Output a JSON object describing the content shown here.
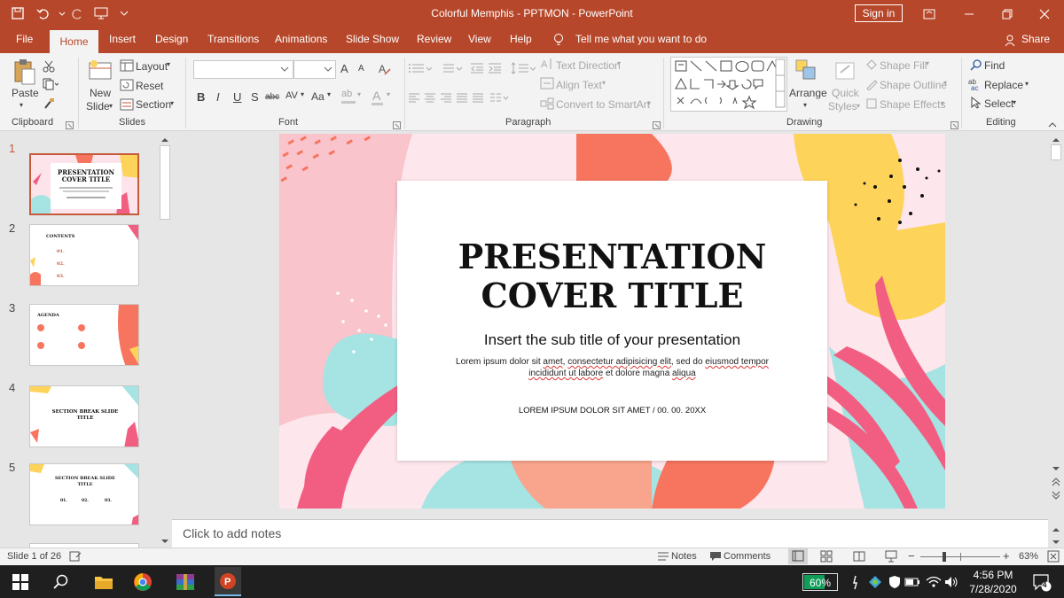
{
  "window": {
    "doc_title": "Colorful Memphis - PPTMON  -  PowerPoint",
    "sign_in": "Sign in"
  },
  "tabs": [
    "File",
    "Home",
    "Insert",
    "Design",
    "Transitions",
    "Animations",
    "Slide Show",
    "Review",
    "View",
    "Help"
  ],
  "tell_me": "Tell me what you want to do",
  "share": "Share",
  "ribbon": {
    "clipboard": {
      "paste": "Paste",
      "group": "Clipboard"
    },
    "slides": {
      "new_line1": "New",
      "new_line2": "Slide",
      "layout": "Layout",
      "reset": "Reset",
      "section": "Section",
      "group": "Slides"
    },
    "font": {
      "group": "Font",
      "style_buttons": [
        "B",
        "I",
        "U",
        "S",
        "abc",
        "AV",
        "Aa"
      ],
      "grow": "A",
      "shrink": "A",
      "color": "A",
      "highlight": "ab"
    },
    "paragraph": {
      "text_direction": "Text Direction",
      "align_text": "Align Text",
      "convert_smartart": "Convert to SmartArt",
      "group": "Paragraph"
    },
    "drawing": {
      "arrange": "Arrange",
      "quick_styles_1": "Quick",
      "quick_styles_2": "Styles",
      "shape_fill": "Shape Fill",
      "shape_outline": "Shape Outline",
      "shape_effects": "Shape Effects",
      "group": "Drawing"
    },
    "editing": {
      "find": "Find",
      "replace": "Replace",
      "select": "Select",
      "group": "Editing"
    }
  },
  "thumbnails": [
    {
      "num": "1",
      "title": "PRESENTATION COVER TITLE"
    },
    {
      "num": "2",
      "title": "CONTENTS",
      "items": [
        "01.",
        "02.",
        "03."
      ]
    },
    {
      "num": "3",
      "title": "AGENDA"
    },
    {
      "num": "4",
      "title": "SECTION BREAK SLIDE TITLE"
    },
    {
      "num": "5",
      "title": "SECTION BREAK SLIDE TITLE",
      "items": [
        "01.",
        "02.",
        "03."
      ]
    }
  ],
  "slide": {
    "title_line1": "PRESENTATION",
    "title_line2": "COVER TITLE",
    "subtitle": "Insert the sub title of your presentation",
    "body": {
      "plain1": "Lorem ipsum dolor sit ",
      "u1": "amet",
      "plain2": ", ",
      "u2": "consectetur adipisicing elit",
      "plain3": ", sed do ",
      "u3": "eiusmod tempor incididunt ut labore",
      "plain4": " et dolore magna ",
      "u4": "aliqua"
    },
    "dateline": "LOREM IPSUM DOLOR SIT AMET  /  00. 00. 20XX"
  },
  "notes_placeholder": "Click to add notes",
  "status": {
    "slide_count": "Slide 1 of 26",
    "notes": "Notes",
    "comments": "Comments",
    "zoom": "63%",
    "zoom_level": 0.63
  },
  "taskbar": {
    "battery": "60%",
    "time": "4:56 PM",
    "date": "7/28/2020",
    "notifications": "4"
  },
  "colors": {
    "accent": "#b7472a",
    "coral": "#f7755f",
    "pink": "#f25e82",
    "yellow": "#fdd35a",
    "mint": "#a6e3e3"
  }
}
